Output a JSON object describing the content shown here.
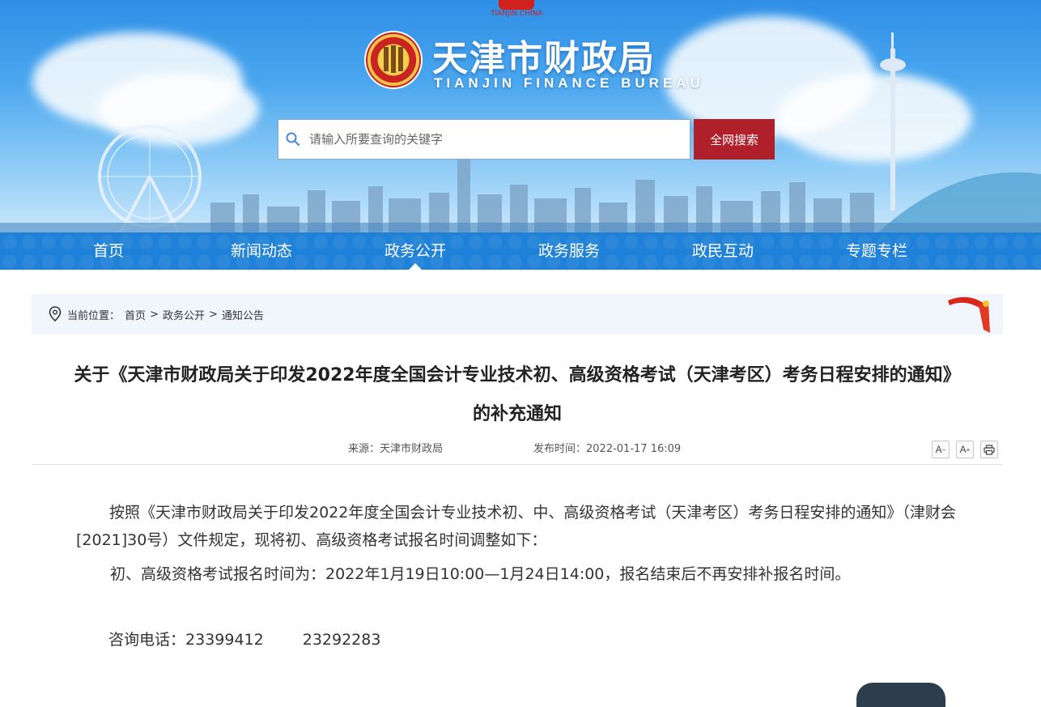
{
  "header": {
    "emblem_text": "TIANJIN.CHINA",
    "site_title": "天津市财政局",
    "site_subtitle": "TIANJIN FINANCE BUREAU",
    "search": {
      "placeholder": "请输入所要查询的关键字",
      "button_label": "全网搜索",
      "icon": "search-icon"
    }
  },
  "nav": {
    "items": [
      {
        "label": "首页"
      },
      {
        "label": "新闻动态"
      },
      {
        "label": "政务公开",
        "active": true
      },
      {
        "label": "政务服务"
      },
      {
        "label": "政民互动"
      },
      {
        "label": "专题专栏"
      }
    ]
  },
  "breadcrumb": {
    "prefix": "当前位置：",
    "items": [
      "首页",
      "政务公开",
      "通知公告"
    ],
    "separator": ">"
  },
  "article": {
    "title_line1": "关于《天津市财政局关于印发2022年度全国会计专业技术初、高级资格考试（天津考区）考务日程安排的通知》",
    "title_line2": "的补充通知",
    "source_label": "来源：",
    "source": "天津市财政局",
    "date_label": "发布时间：",
    "date": "2022-01-17 16:09",
    "tools": {
      "font_smaller": "A",
      "font_larger": "A",
      "print_icon": "print-icon"
    },
    "paragraphs": {
      "p1": "按照《天津市财政局关于印发2022年度全国会计专业技术初、中、高级资格考试（天津考区）考务日程安排的通知》（津财会[2021]30号）文件规定，现将初、高级资格考试报名时间调整如下：",
      "p2": "初、高级资格考试报名时间为：2022年1月19日10:00—1月24日14:00，报名结束后不再安排补报名时间。",
      "phone_label": "咨询电话：",
      "phone1": "23399412",
      "phone2": "23292283"
    }
  },
  "colors": {
    "nav_bg": "#1f82d8",
    "search_button": "#b0202a",
    "breadcrumb_bg": "#f0f6fc"
  }
}
